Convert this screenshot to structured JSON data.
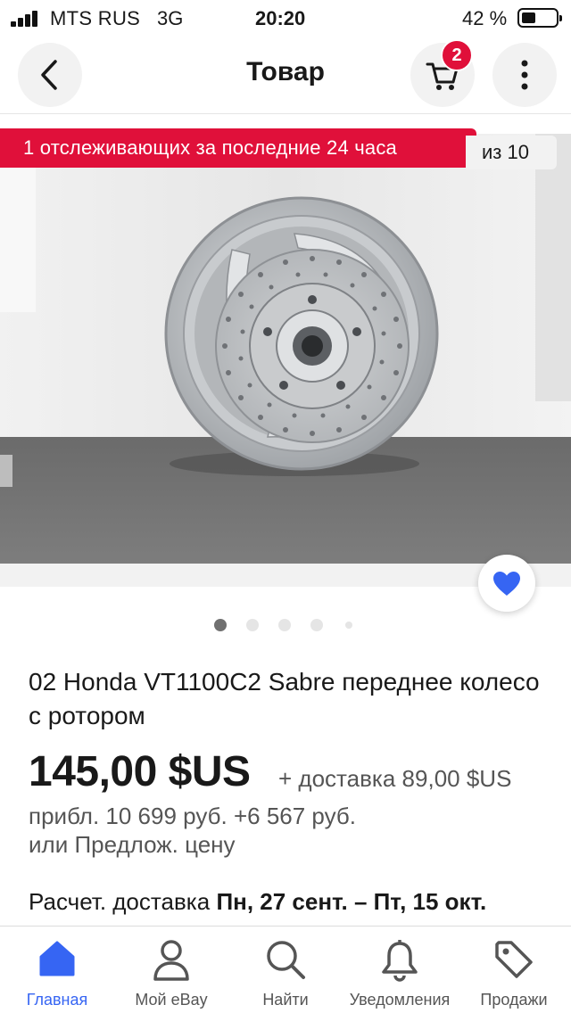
{
  "status_bar": {
    "carrier": "MTS RUS",
    "network": "3G",
    "time": "20:20",
    "battery_percent": "42 %",
    "battery_level": 0.42,
    "signal_bars": 4
  },
  "header": {
    "title": "Товар",
    "cart_count": "2",
    "icons": {
      "back": "chevron-left-icon",
      "cart": "cart-icon",
      "more": "more-vertical-icon"
    }
  },
  "gallery": {
    "watchers_banner": "1 отслеживающих за последние 24 часа",
    "image_counter": "из 10",
    "image_description_icon": "wheel-photo",
    "total_dots": 5,
    "active_dot": 0,
    "favorite_icon": "heart-icon"
  },
  "product": {
    "title": "02 Honda VT1100C2 Sabre переднее колесо с ротором",
    "price": "145,00 $US",
    "shipping": "+ доставка 89,00 $US",
    "approx": "прибл. 10 699 руб. +6 567 руб.",
    "offer": "или Предлож. цену",
    "delivery_label": "Расчет. доставка",
    "delivery_dates": "Пн, 27 сент. – Пт, 15 окт."
  },
  "colors": {
    "accent": "#3665f3",
    "banner_red": "#e0103a",
    "text": "#191919",
    "muted": "#555555"
  },
  "tabbar": {
    "tabs": [
      {
        "label": "Главная",
        "icon": "home-icon",
        "active": true
      },
      {
        "label": "Мой eBay",
        "icon": "user-icon",
        "active": false
      },
      {
        "label": "Найти",
        "icon": "search-icon",
        "active": false
      },
      {
        "label": "Уведомления",
        "icon": "bell-icon",
        "active": false
      },
      {
        "label": "Продажи",
        "icon": "tag-icon",
        "active": false
      }
    ]
  }
}
